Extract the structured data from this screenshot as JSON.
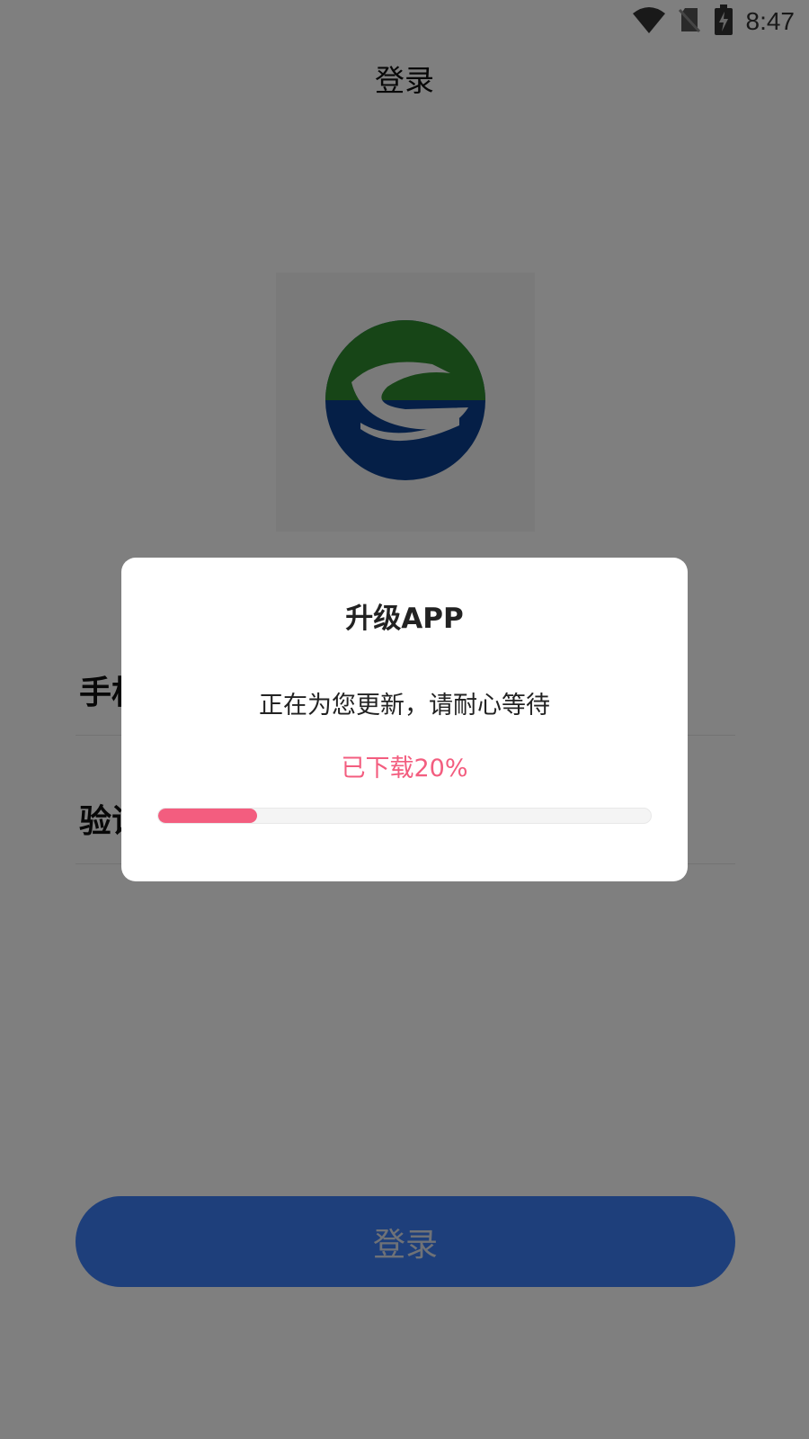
{
  "status_bar": {
    "time": "8:47",
    "icons": [
      "wifi-icon",
      "no-sim-icon",
      "battery-charging-icon"
    ]
  },
  "header": {
    "title": "登录"
  },
  "logo": {
    "icon": "app-logo-icon",
    "colors": {
      "green": "#2e8b2e",
      "blue": "#0b3f8f"
    }
  },
  "form": {
    "phone_label": "手机",
    "code_label": "验证"
  },
  "login_button": {
    "label": "登录",
    "color": "#3d7ef7"
  },
  "dialog": {
    "title": "升级APP",
    "message": "正在为您更新，请耐心等待",
    "progress_text": "已下载20%",
    "progress": 0.2,
    "accent_color": "#f35d7f"
  }
}
